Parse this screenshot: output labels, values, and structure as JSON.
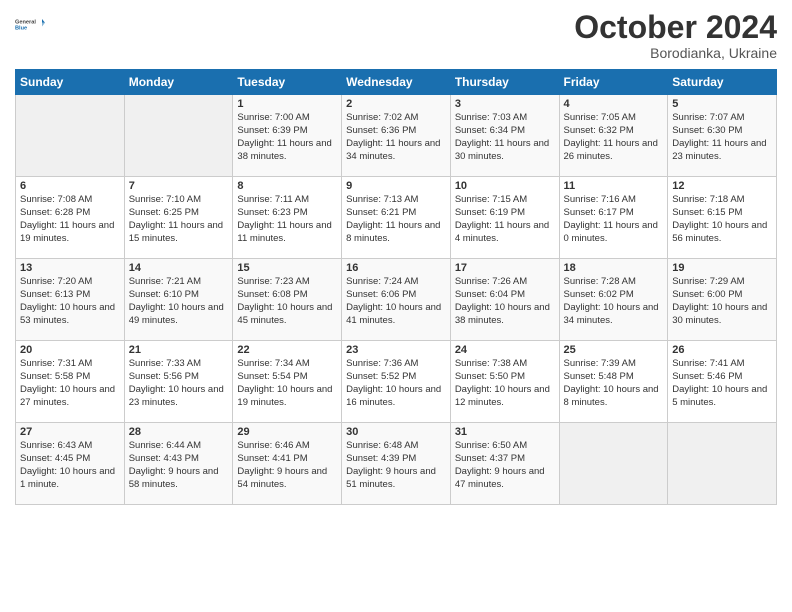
{
  "logo": {
    "line1": "General",
    "line2": "Blue"
  },
  "title": "October 2024",
  "location": "Borodianka, Ukraine",
  "weekdays": [
    "Sunday",
    "Monday",
    "Tuesday",
    "Wednesday",
    "Thursday",
    "Friday",
    "Saturday"
  ],
  "weeks": [
    [
      {
        "day": "",
        "info": ""
      },
      {
        "day": "",
        "info": ""
      },
      {
        "day": "1",
        "info": "Sunrise: 7:00 AM\nSunset: 6:39 PM\nDaylight: 11 hours\nand 38 minutes."
      },
      {
        "day": "2",
        "info": "Sunrise: 7:02 AM\nSunset: 6:36 PM\nDaylight: 11 hours\nand 34 minutes."
      },
      {
        "day": "3",
        "info": "Sunrise: 7:03 AM\nSunset: 6:34 PM\nDaylight: 11 hours\nand 30 minutes."
      },
      {
        "day": "4",
        "info": "Sunrise: 7:05 AM\nSunset: 6:32 PM\nDaylight: 11 hours\nand 26 minutes."
      },
      {
        "day": "5",
        "info": "Sunrise: 7:07 AM\nSunset: 6:30 PM\nDaylight: 11 hours\nand 23 minutes."
      }
    ],
    [
      {
        "day": "6",
        "info": "Sunrise: 7:08 AM\nSunset: 6:28 PM\nDaylight: 11 hours\nand 19 minutes."
      },
      {
        "day": "7",
        "info": "Sunrise: 7:10 AM\nSunset: 6:25 PM\nDaylight: 11 hours\nand 15 minutes."
      },
      {
        "day": "8",
        "info": "Sunrise: 7:11 AM\nSunset: 6:23 PM\nDaylight: 11 hours\nand 11 minutes."
      },
      {
        "day": "9",
        "info": "Sunrise: 7:13 AM\nSunset: 6:21 PM\nDaylight: 11 hours\nand 8 minutes."
      },
      {
        "day": "10",
        "info": "Sunrise: 7:15 AM\nSunset: 6:19 PM\nDaylight: 11 hours\nand 4 minutes."
      },
      {
        "day": "11",
        "info": "Sunrise: 7:16 AM\nSunset: 6:17 PM\nDaylight: 11 hours\nand 0 minutes."
      },
      {
        "day": "12",
        "info": "Sunrise: 7:18 AM\nSunset: 6:15 PM\nDaylight: 10 hours\nand 56 minutes."
      }
    ],
    [
      {
        "day": "13",
        "info": "Sunrise: 7:20 AM\nSunset: 6:13 PM\nDaylight: 10 hours\nand 53 minutes."
      },
      {
        "day": "14",
        "info": "Sunrise: 7:21 AM\nSunset: 6:10 PM\nDaylight: 10 hours\nand 49 minutes."
      },
      {
        "day": "15",
        "info": "Sunrise: 7:23 AM\nSunset: 6:08 PM\nDaylight: 10 hours\nand 45 minutes."
      },
      {
        "day": "16",
        "info": "Sunrise: 7:24 AM\nSunset: 6:06 PM\nDaylight: 10 hours\nand 41 minutes."
      },
      {
        "day": "17",
        "info": "Sunrise: 7:26 AM\nSunset: 6:04 PM\nDaylight: 10 hours\nand 38 minutes."
      },
      {
        "day": "18",
        "info": "Sunrise: 7:28 AM\nSunset: 6:02 PM\nDaylight: 10 hours\nand 34 minutes."
      },
      {
        "day": "19",
        "info": "Sunrise: 7:29 AM\nSunset: 6:00 PM\nDaylight: 10 hours\nand 30 minutes."
      }
    ],
    [
      {
        "day": "20",
        "info": "Sunrise: 7:31 AM\nSunset: 5:58 PM\nDaylight: 10 hours\nand 27 minutes."
      },
      {
        "day": "21",
        "info": "Sunrise: 7:33 AM\nSunset: 5:56 PM\nDaylight: 10 hours\nand 23 minutes."
      },
      {
        "day": "22",
        "info": "Sunrise: 7:34 AM\nSunset: 5:54 PM\nDaylight: 10 hours\nand 19 minutes."
      },
      {
        "day": "23",
        "info": "Sunrise: 7:36 AM\nSunset: 5:52 PM\nDaylight: 10 hours\nand 16 minutes."
      },
      {
        "day": "24",
        "info": "Sunrise: 7:38 AM\nSunset: 5:50 PM\nDaylight: 10 hours\nand 12 minutes."
      },
      {
        "day": "25",
        "info": "Sunrise: 7:39 AM\nSunset: 5:48 PM\nDaylight: 10 hours\nand 8 minutes."
      },
      {
        "day": "26",
        "info": "Sunrise: 7:41 AM\nSunset: 5:46 PM\nDaylight: 10 hours\nand 5 minutes."
      }
    ],
    [
      {
        "day": "27",
        "info": "Sunrise: 6:43 AM\nSunset: 4:45 PM\nDaylight: 10 hours\nand 1 minute."
      },
      {
        "day": "28",
        "info": "Sunrise: 6:44 AM\nSunset: 4:43 PM\nDaylight: 9 hours\nand 58 minutes."
      },
      {
        "day": "29",
        "info": "Sunrise: 6:46 AM\nSunset: 4:41 PM\nDaylight: 9 hours\nand 54 minutes."
      },
      {
        "day": "30",
        "info": "Sunrise: 6:48 AM\nSunset: 4:39 PM\nDaylight: 9 hours\nand 51 minutes."
      },
      {
        "day": "31",
        "info": "Sunrise: 6:50 AM\nSunset: 4:37 PM\nDaylight: 9 hours\nand 47 minutes."
      },
      {
        "day": "",
        "info": ""
      },
      {
        "day": "",
        "info": ""
      }
    ]
  ]
}
